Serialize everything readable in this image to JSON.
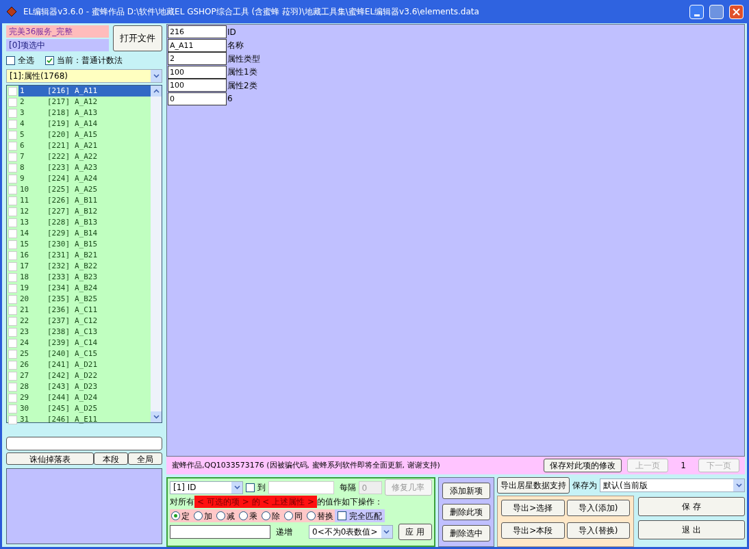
{
  "window": {
    "title": "EL编辑器v3.6.0  -  蜜蜂作品  D:\\软件\\地藏EL GSHOP综合工具 (含蜜蜂 菈羽)\\地藏工具集\\蜜蜂EL编辑器v3.6\\elements.data"
  },
  "left": {
    "server": "完美36服务_完整",
    "selection_count": "[0]项选中",
    "open_button": "打开文件",
    "select_all": {
      "label": "全选",
      "checked": false
    },
    "counting": {
      "label": "当前：普通计数法",
      "checked": true
    },
    "category": "[1]:属性(1768)",
    "rows": [
      {
        "index": "1",
        "id": "[216]",
        "name": "A_A11",
        "checked": false,
        "selected": true
      },
      {
        "index": "2",
        "id": "[217]",
        "name": "A_A12",
        "checked": false,
        "selected": false
      },
      {
        "index": "3",
        "id": "[218]",
        "name": "A_A13",
        "checked": false,
        "selected": false
      },
      {
        "index": "4",
        "id": "[219]",
        "name": "A_A14",
        "checked": false,
        "selected": false
      },
      {
        "index": "5",
        "id": "[220]",
        "name": "A_A15",
        "checked": false,
        "selected": false
      },
      {
        "index": "6",
        "id": "[221]",
        "name": "A_A21",
        "checked": false,
        "selected": false
      },
      {
        "index": "7",
        "id": "[222]",
        "name": "A_A22",
        "checked": false,
        "selected": false
      },
      {
        "index": "8",
        "id": "[223]",
        "name": "A_A23",
        "checked": false,
        "selected": false
      },
      {
        "index": "9",
        "id": "[224]",
        "name": "A_A24",
        "checked": false,
        "selected": false
      },
      {
        "index": "10",
        "id": "[225]",
        "name": "A_A25",
        "checked": false,
        "selected": false
      },
      {
        "index": "11",
        "id": "[226]",
        "name": "A_B11",
        "checked": false,
        "selected": false
      },
      {
        "index": "12",
        "id": "[227]",
        "name": "A_B12",
        "checked": false,
        "selected": false
      },
      {
        "index": "13",
        "id": "[228]",
        "name": "A_B13",
        "checked": false,
        "selected": false
      },
      {
        "index": "14",
        "id": "[229]",
        "name": "A_B14",
        "checked": false,
        "selected": false
      },
      {
        "index": "15",
        "id": "[230]",
        "name": "A_B15",
        "checked": false,
        "selected": false
      },
      {
        "index": "16",
        "id": "[231]",
        "name": "A_B21",
        "checked": false,
        "selected": false
      },
      {
        "index": "17",
        "id": "[232]",
        "name": "A_B22",
        "checked": false,
        "selected": false
      },
      {
        "index": "18",
        "id": "[233]",
        "name": "A_B23",
        "checked": false,
        "selected": false
      },
      {
        "index": "19",
        "id": "[234]",
        "name": "A_B24",
        "checked": false,
        "selected": false
      },
      {
        "index": "20",
        "id": "[235]",
        "name": "A_B25",
        "checked": false,
        "selected": false
      },
      {
        "index": "21",
        "id": "[236]",
        "name": "A_C11",
        "checked": false,
        "selected": false
      },
      {
        "index": "22",
        "id": "[237]",
        "name": "A_C12",
        "checked": false,
        "selected": false
      },
      {
        "index": "23",
        "id": "[238]",
        "name": "A_C13",
        "checked": false,
        "selected": false
      },
      {
        "index": "24",
        "id": "[239]",
        "name": "A_C14",
        "checked": false,
        "selected": false
      },
      {
        "index": "25",
        "id": "[240]",
        "name": "A_C15",
        "checked": false,
        "selected": false
      },
      {
        "index": "26",
        "id": "[241]",
        "name": "A_D21",
        "checked": false,
        "selected": false
      },
      {
        "index": "27",
        "id": "[242]",
        "name": "A_D22",
        "checked": false,
        "selected": false
      },
      {
        "index": "28",
        "id": "[243]",
        "name": "A_D23",
        "checked": false,
        "selected": false
      },
      {
        "index": "29",
        "id": "[244]",
        "name": "A_D24",
        "checked": false,
        "selected": false
      },
      {
        "index": "30",
        "id": "[245]",
        "name": "A_D25",
        "checked": false,
        "selected": false
      },
      {
        "index": "31",
        "id": "[246]",
        "name": "A_E11",
        "checked": false,
        "selected": false
      }
    ],
    "buttons": [
      "诛仙掉落表",
      "本段",
      "全局"
    ]
  },
  "fields": [
    {
      "value": "216",
      "label": "ID"
    },
    {
      "value": "A_A11",
      "label": "名称"
    },
    {
      "value": "2",
      "label": "属性类型"
    },
    {
      "value": "100",
      "label": "属性1类"
    },
    {
      "value": "100",
      "label": "属性2类"
    },
    {
      "value": "0",
      "label": "6"
    }
  ],
  "status": {
    "message": "蜜蜂作品,QQ1033573176 (因被骗代码, 蜜蜂系列软件即将全面更新, 谢谢支持)",
    "save_button": "保存对此项的修改",
    "prev": {
      "label": "上一页",
      "disabled": true
    },
    "page": "1",
    "next": {
      "label": "下一页",
      "disabled": true
    }
  },
  "batch": {
    "field": "[1] ID",
    "to_label": "到",
    "to_checked": false,
    "interval_label": "每隔",
    "interval": "0",
    "repeat_button": "修复几率",
    "target_prefix": "对所有",
    "target_highlight": "< 可选的项 > 的 < 上述属性 >",
    "target_suffix": "的值作如下操作：",
    "operations": [
      {
        "label": "定",
        "selected": true
      },
      {
        "label": "加",
        "selected": false
      },
      {
        "label": "减",
        "selected": false
      },
      {
        "label": "乘",
        "selected": false
      },
      {
        "label": "除",
        "selected": false
      },
      {
        "label": "同",
        "selected": false
      },
      {
        "label": "替换",
        "selected": false
      }
    ],
    "exact_match": {
      "label": "完全匹配",
      "checked": false
    },
    "increment_label": "递增",
    "increment_mode": "0<不为0表数值>",
    "apply_button": "应 用"
  },
  "item_buttons": [
    "添加新项",
    "删除此项",
    "删除选中"
  ],
  "export": {
    "resident_button": "导出居星数据支持",
    "save_as_label": "保存为",
    "save_as": "默认(当前版",
    "buttons": [
      "导出>选择",
      "导入(添加)",
      "导出>本段",
      "导入(替换)"
    ],
    "save_button": "保 存",
    "exit_button": "退 出"
  }
}
